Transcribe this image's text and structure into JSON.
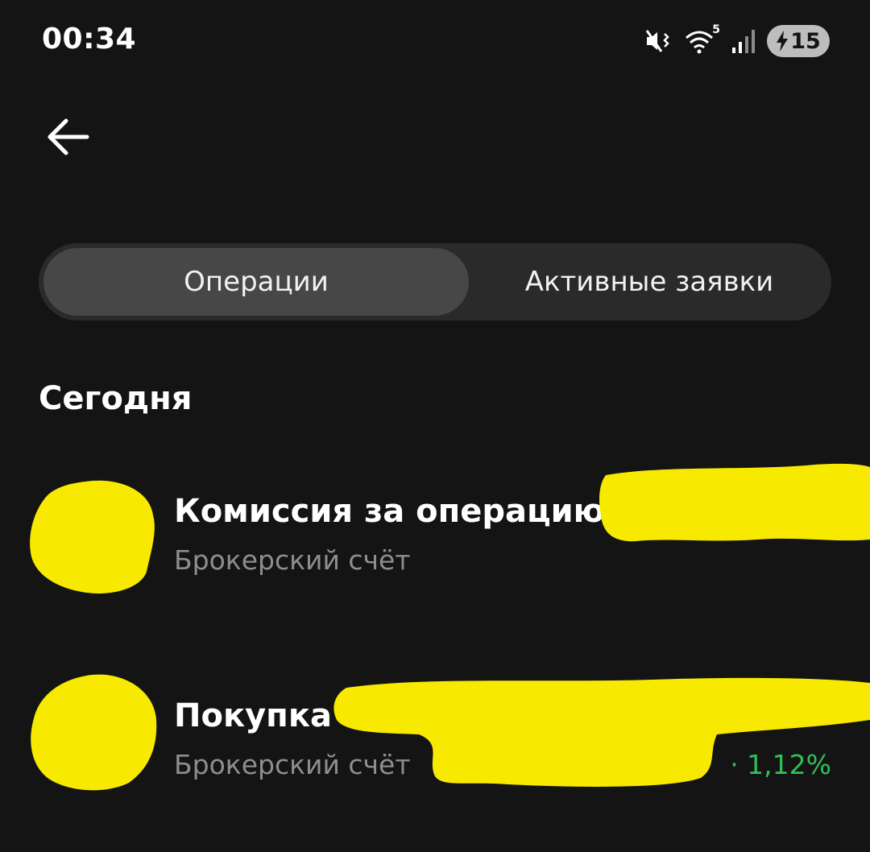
{
  "status_bar": {
    "time": "00:34",
    "network_label": "5",
    "battery_level": "15",
    "icons": [
      "mute-vibrate-icon",
      "wifi-icon",
      "signal-icon",
      "battery-charging-icon"
    ]
  },
  "header": {
    "back_icon": "arrow-left-icon"
  },
  "tabs": [
    {
      "label": "Операции",
      "active": true
    },
    {
      "label": "Активные заявки",
      "active": false
    }
  ],
  "section": {
    "title": "Сегодня"
  },
  "operations": [
    {
      "title": "Комиссия за операцию",
      "subtitle": "Брокерский счёт",
      "change": ""
    },
    {
      "title": "Покупка",
      "subtitle": "Брокерский счёт",
      "change": "· 1,12%"
    }
  ],
  "colors": {
    "background": "#141414",
    "redaction": "#f7ea00",
    "positive": "#2fbf5a",
    "muted_text": "#8e8e8e"
  }
}
